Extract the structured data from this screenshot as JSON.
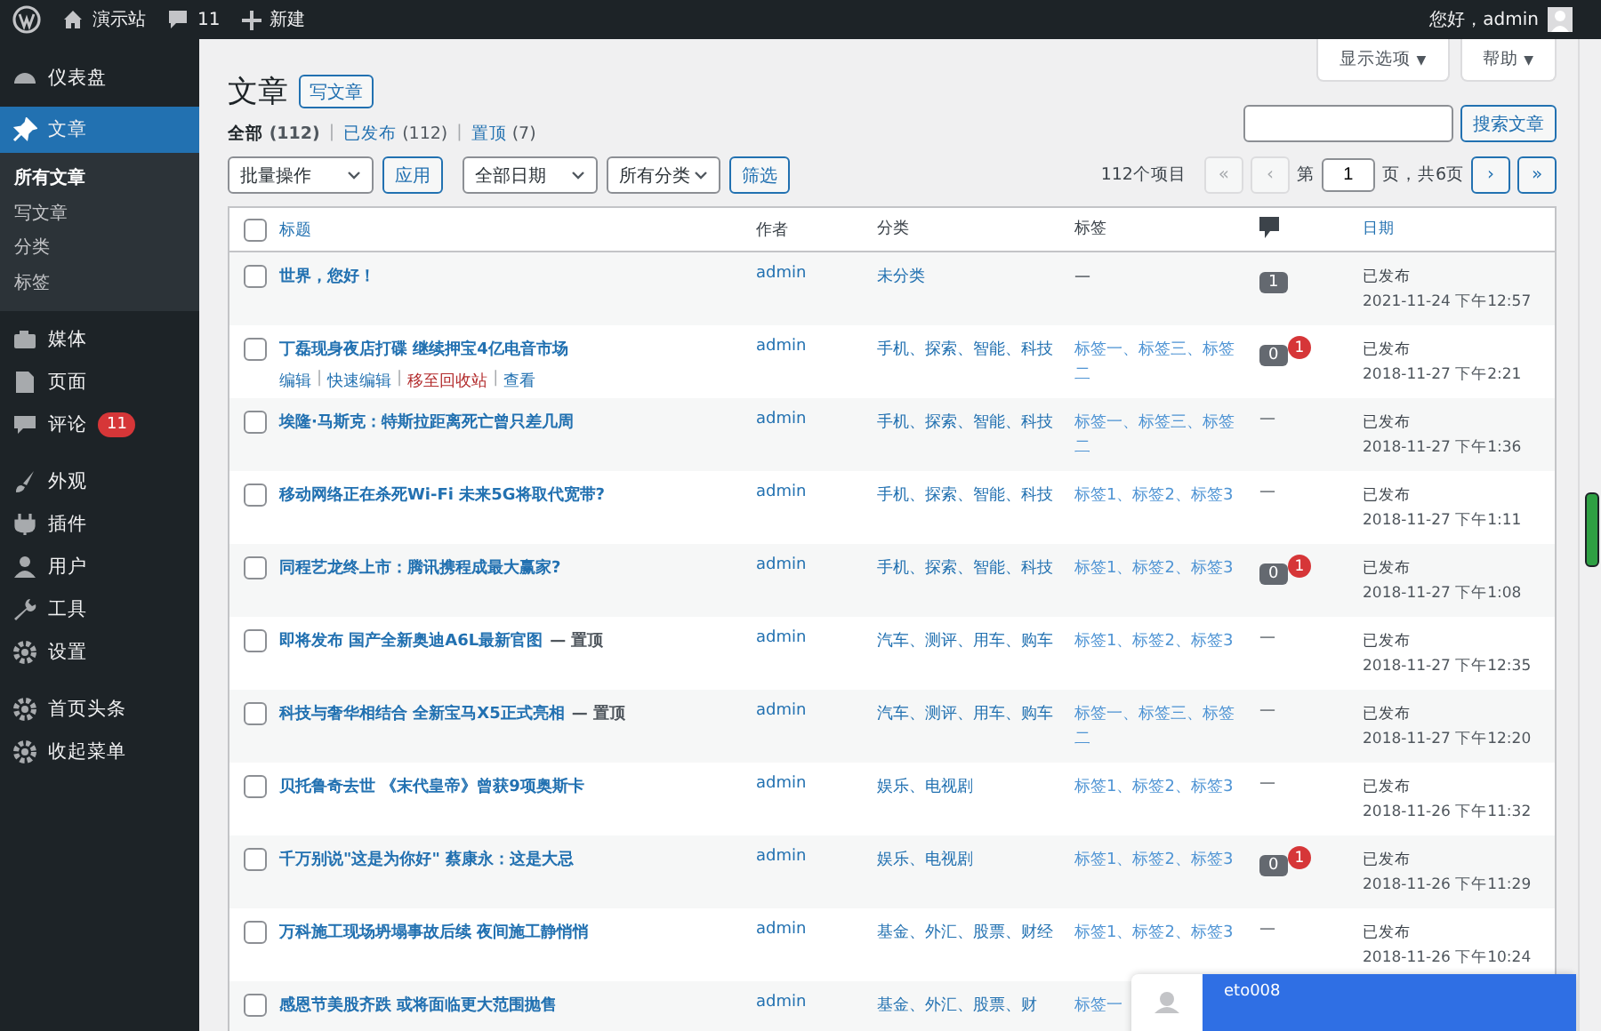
{
  "admin_bar": {
    "site_name": "演示站",
    "comments_count": "11",
    "new_label": "新建",
    "greeting": "您好，admin"
  },
  "sidebar": {
    "items": [
      {
        "label": "仪表盘",
        "selected": false
      },
      {
        "label": "文章",
        "selected": true,
        "children": [
          {
            "label": "所有文章",
            "selected": true
          },
          {
            "label": "写文章",
            "selected": false
          },
          {
            "label": "分类",
            "selected": false
          },
          {
            "label": "标签",
            "selected": false
          }
        ]
      },
      {
        "label": "媒体",
        "selected": false
      },
      {
        "label": "页面",
        "selected": false
      },
      {
        "label": "评论",
        "selected": false,
        "badge": "11"
      },
      {
        "label": "外观",
        "selected": false
      },
      {
        "label": "插件",
        "selected": false
      },
      {
        "label": "用户",
        "selected": false
      },
      {
        "label": "工具",
        "selected": false
      },
      {
        "label": "设置",
        "selected": false
      },
      {
        "label": "首页头条",
        "selected": false
      },
      {
        "label": "收起菜单",
        "selected": false
      }
    ]
  },
  "screen_tabs": [
    {
      "label": "显示选项",
      "caret": "▼"
    },
    {
      "label": "帮助",
      "caret": "▼"
    }
  ],
  "heading": {
    "title": "文章",
    "add_button": "写文章"
  },
  "status_links": [
    {
      "label": "全部",
      "count": "(112)",
      "selected": true
    },
    {
      "label": "已发布",
      "count": "(112)",
      "selected": false,
      "separator": "|"
    },
    {
      "label": "置顶",
      "count": "(7)",
      "selected": false,
      "separator": "|"
    }
  ],
  "search": {
    "button": "搜索文章"
  },
  "filters": {
    "bulk_action": "批量操作",
    "apply": "应用",
    "date": "全部日期",
    "category": "所有分类",
    "filter": "筛选"
  },
  "pagination": {
    "total": "112个项目",
    "first": "«",
    "prev": "‹",
    "page_prefix": "第",
    "page": "1",
    "page_suffix": "页，共6页",
    "next": "›",
    "last": "»"
  },
  "table": {
    "select_all_checked": false,
    "columns": [
      "标题",
      "作者",
      "分类",
      "标签",
      "日期"
    ],
    "rows": [
      {
        "checked": false,
        "title": "世界，您好！",
        "author": "admin",
        "categories": "未分类",
        "tags": "—",
        "comments": {
          "kind": "bubble",
          "count": "1"
        },
        "status": "已发布",
        "date": "2021-11-24 下午12:57"
      },
      {
        "checked": false,
        "title": "丁磊现身夜店打碟 继续押宝4亿电音市场",
        "actions": [
          {
            "label": "编辑",
            "kind": "link"
          },
          {
            "label": "快速编辑",
            "kind": "link",
            "separator": "|"
          },
          {
            "label": "移至回收站",
            "kind": "danger",
            "separator": "|"
          },
          {
            "label": "查看",
            "kind": "link",
            "separator": "|"
          }
        ],
        "author": "admin",
        "categories": "手机、探索、智能、科技",
        "tags": "标签一、标签三、标签二",
        "comments": {
          "kind": "bubble",
          "count": "0",
          "pending": "1"
        },
        "status": "已发布",
        "date": "2018-11-27 下午2:21"
      },
      {
        "checked": false,
        "title": "埃隆·马斯克：特斯拉距离死亡曾只差几周",
        "author": "admin",
        "categories": "手机、探索、智能、科技",
        "tags": "标签一、标签三、标签二",
        "comments": {
          "kind": "none",
          "text": "—"
        },
        "status": "已发布",
        "date": "2018-11-27 下午1:36"
      },
      {
        "checked": false,
        "title": "移动网络正在杀死Wi-Fi 未来5G将取代宽带?",
        "author": "admin",
        "categories": "手机、探索、智能、科技",
        "tags": "标签1、标签2、标签3",
        "comments": {
          "kind": "none",
          "text": "—"
        },
        "status": "已发布",
        "date": "2018-11-27 下午1:11"
      },
      {
        "checked": false,
        "title": "同程艺龙终上市：腾讯携程成最大赢家?",
        "author": "admin",
        "categories": "手机、探索、智能、科技",
        "tags": "标签1、标签2、标签3",
        "comments": {
          "kind": "bubble",
          "count": "0",
          "pending": "1"
        },
        "status": "已发布",
        "date": "2018-11-27 下午1:08"
      },
      {
        "checked": false,
        "title": "即将发布 国产全新奥迪A6L最新官图",
        "sticky": "— 置顶",
        "author": "admin",
        "categories": "汽车、测评、用车、购车",
        "tags": "标签1、标签2、标签3",
        "comments": {
          "kind": "none",
          "text": "—"
        },
        "status": "已发布",
        "date": "2018-11-27 下午12:35"
      },
      {
        "checked": false,
        "title": "科技与奢华相结合 全新宝马X5正式亮相",
        "sticky": "— 置顶",
        "author": "admin",
        "categories": "汽车、测评、用车、购车",
        "tags": "标签一、标签三、标签二",
        "comments": {
          "kind": "none",
          "text": "—"
        },
        "status": "已发布",
        "date": "2018-11-27 下午12:20"
      },
      {
        "checked": false,
        "title": "贝托鲁奇去世 《末代皇帝》曾获9项奥斯卡",
        "author": "admin",
        "categories": "娱乐、电视剧",
        "tags": "标签1、标签2、标签3",
        "comments": {
          "kind": "none",
          "text": "—"
        },
        "status": "已发布",
        "date": "2018-11-26 下午11:32"
      },
      {
        "checked": false,
        "title": "千万别说\"这是为你好\" 蔡康永：这是大忌",
        "author": "admin",
        "categories": "娱乐、电视剧",
        "tags": "标签1、标签2、标签3",
        "comments": {
          "kind": "bubble",
          "count": "0",
          "pending": "1"
        },
        "status": "已发布",
        "date": "2018-11-26 下午11:29"
      },
      {
        "checked": false,
        "title": "万科施工现场坍塌事故后续 夜间施工静悄悄",
        "author": "admin",
        "categories": "基金、外汇、股票、财经",
        "tags": "标签1、标签2、标签3",
        "comments": {
          "kind": "none",
          "text": "—"
        },
        "status": "已发布",
        "date": "2018-11-26 下午10:24"
      },
      {
        "checked": false,
        "title": "感恩节美股齐跌 或将面临更大范围抛售",
        "author": "admin",
        "categories": "基金、外汇、股票、财",
        "tags": "标签一"
      }
    ]
  },
  "chat_popup": {
    "name": "eto008"
  }
}
